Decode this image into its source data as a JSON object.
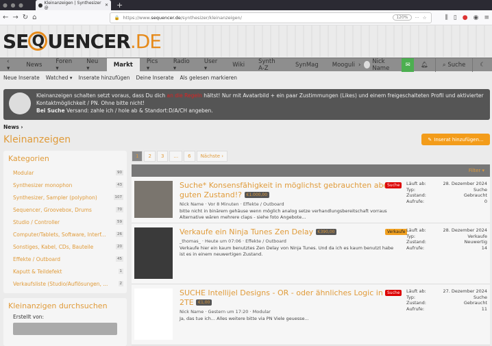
{
  "browser": {
    "tab_title": "Kleinanzeigen | Synthesizer @",
    "url_prefix": "https://www.",
    "url_domain": "sequencer.de",
    "url_path": "/synthesizer/kleinanzeigen/",
    "zoom": "120%"
  },
  "logo": {
    "a": "SE",
    "q": "Q",
    "b": "UENCER",
    "c": ".DE"
  },
  "nav": {
    "items": [
      "News",
      "Foren ▾",
      "Neu ▾",
      "Markt",
      "Pics ▾",
      "Radio ▾",
      "User ▾",
      "Wiki",
      "Synth A-Z",
      "SynMag",
      "Mooguli"
    ],
    "user": "Nick Name",
    "search": "Suche"
  },
  "subnav": [
    "Neue Inserate",
    "Watched ▾",
    "Inserate hinzufügen",
    "Deine Inserate",
    "Als gelesen markieren"
  ],
  "notice": {
    "p1": "Kleinanzeigen schalten setzt voraus, dass Du dich ",
    "link": "an die Regeln",
    "p2": " hältst! Nur mit Avatarbild + ein paar Zustimmungen (Likes) und einem freigeschalteten Profil und aktivierter Kontaktmöglichkeit / PN. Ohne bitte nicht!",
    "bold": "Bei Suche",
    "p3": " Versand: zahle ich / hole ab & Standort:D/A/CH angeben."
  },
  "breadcrumb": "News ›",
  "title": "Kleinanzeigen",
  "add_button": "Inserat hinzufügen...",
  "categories": {
    "title": "Kategorien",
    "items": [
      {
        "label": "Modular",
        "count": "90"
      },
      {
        "label": "Synthesizer monophon",
        "count": "43"
      },
      {
        "label": "Synthesizer, Sampler (polyphon)",
        "count": "107"
      },
      {
        "label": "Sequencer, Groovebox, Drums",
        "count": "70"
      },
      {
        "label": "Studio / Controller",
        "count": "59"
      },
      {
        "label": "Computer/Tablets, Software, Interf...",
        "count": "26"
      },
      {
        "label": "Sonstiges, Kabel, CDs, Bauteile",
        "count": "20"
      },
      {
        "label": "Effekte / Outboard",
        "count": "45"
      },
      {
        "label": "Kaputt & Teildefekt",
        "count": "1"
      },
      {
        "label": "Verkaufsliste (Studio/Auflösungen, ...",
        "count": "2"
      }
    ]
  },
  "search_box": {
    "title": "Kleinanzigen durchsuchen",
    "label": "Erstellt von:"
  },
  "pager": [
    "1",
    "2",
    "3",
    "...",
    "6",
    "Nächste ›"
  ],
  "filter": "Filter ▾",
  "info_labels": [
    "Läuft ab:",
    "Typ:",
    "Zustand:",
    "Aufrufe:"
  ],
  "listings": [
    {
      "title": "Suche* Konsensfähigkeit in möglichst gebrauchten aber guten Zustand!?",
      "price": "€1.000,00",
      "meta": "Nick Name · Vor 8 Minuten · Effekte / Outboard",
      "desc": "bitte nicht in binärem gehäuse wenn möglich analog setze verhandlungsbereitschaft vorraus Alternative wären mehrere claps - siehe foto Angebote...",
      "badge": "Suche",
      "values": [
        "28. Dezember 2024",
        "Suche",
        "Gebraucht",
        "0"
      ]
    },
    {
      "title": "Verkaufe ein Ninja Tunes Zen Delay",
      "price": "€390,00",
      "meta": "_thomas_ · Heute um 07:06 · Effekte / Outboard",
      "desc": "Verkaufe hier ein kaum benutztes Zen Delay von Ninja Tunes. Und da ich es kaum benutzt habe ist es in einem neuwertigen Zustand.",
      "badge": "Verkaufe",
      "values": [
        "28. Dezember 2024",
        "Verkaufe",
        "Neuwertig",
        "14"
      ]
    },
    {
      "title": "SUCHE Intellijel Designs - OR - oder ähnliches Logic in 2TE",
      "price": "€1,00",
      "meta": "Nick Name · Gestern um 17:20 · Modular",
      "desc": "Ja, das tue ich... Alles weitere bitte via PN Viele geuesse...",
      "badge": "Suche",
      "values": [
        "27. Dezember 2024",
        "Suche",
        "Gebraucht",
        "11"
      ]
    }
  ]
}
